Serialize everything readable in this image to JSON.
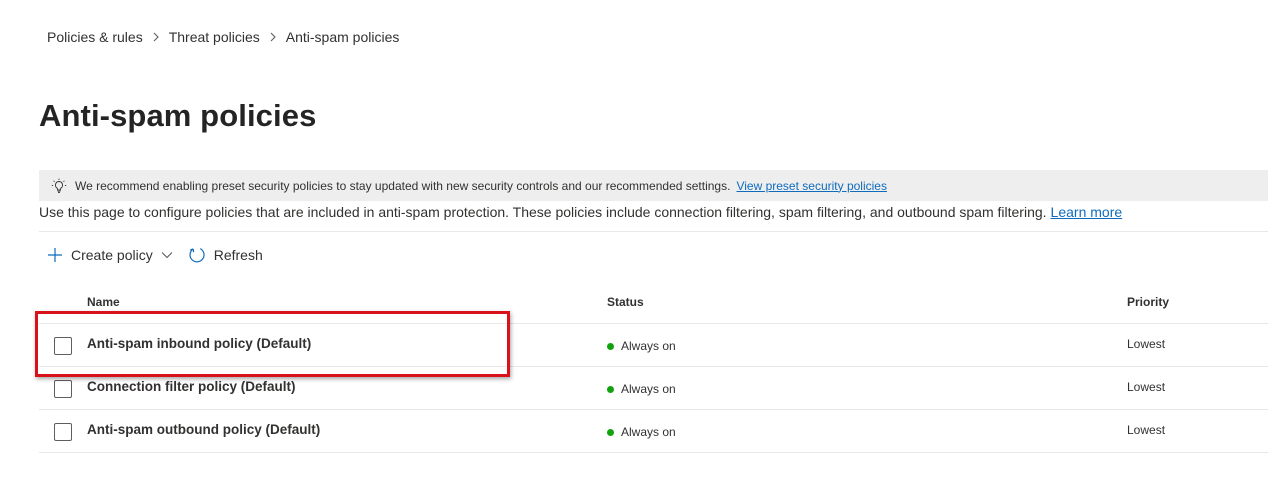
{
  "breadcrumb": {
    "items": [
      "Policies & rules",
      "Threat policies"
    ],
    "current": "Anti-spam policies"
  },
  "page": {
    "title": "Anti-spam policies"
  },
  "banner": {
    "icon": "lightbulb-icon",
    "text": "We recommend enabling preset security policies to stay updated with new security controls and our recommended settings.",
    "link": "View preset security policies"
  },
  "description": {
    "text": "Use this page to configure policies that are included in anti-spam protection. These policies include connection filtering, spam filtering, and outbound spam filtering.",
    "link": "Learn more"
  },
  "toolbar": {
    "create_label": "Create policy",
    "refresh_label": "Refresh"
  },
  "table": {
    "columns": [
      "Name",
      "Status",
      "Priority"
    ],
    "rows": [
      {
        "name": "Anti-spam inbound policy (Default)",
        "status": "Always on",
        "priority": "Lowest"
      },
      {
        "name": "Connection filter policy (Default)",
        "status": "Always on",
        "priority": "Lowest"
      },
      {
        "name": "Anti-spam outbound policy (Default)",
        "status": "Always on",
        "priority": "Lowest"
      }
    ]
  },
  "colors": {
    "link": "#0f6cbd",
    "status_on": "#13a10e",
    "highlight": "#d8111a",
    "banner_bg": "#eeeeee"
  }
}
